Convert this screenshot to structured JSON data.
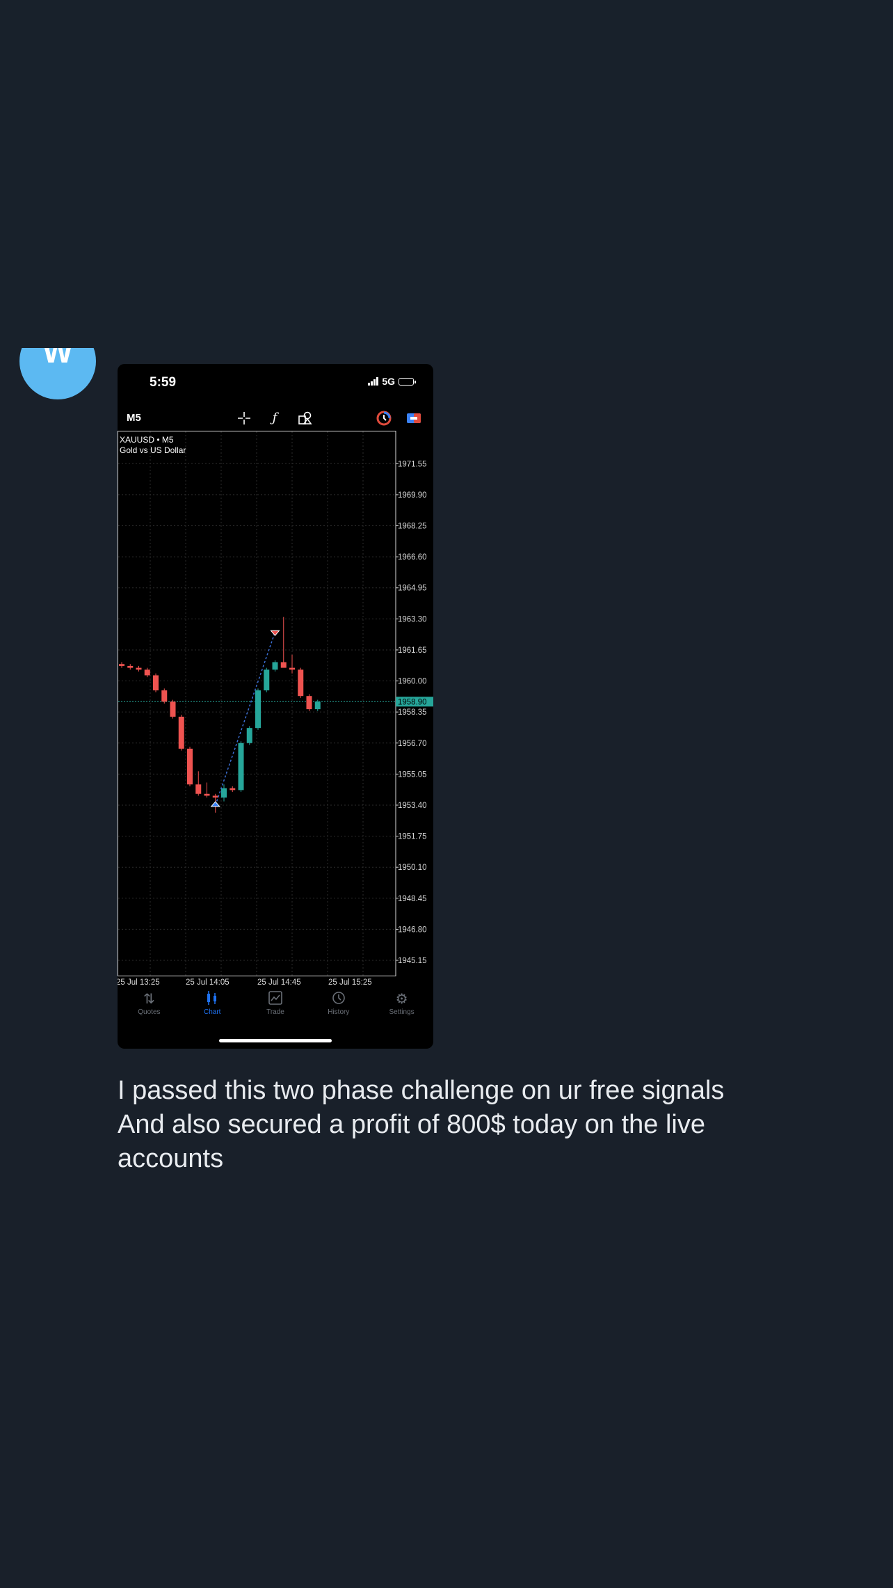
{
  "avatar": {
    "letter": "W",
    "color": "#5cb9f2"
  },
  "status_bar": {
    "time": "5:59",
    "network": "5G"
  },
  "toolbar": {
    "timeframe": "M5",
    "icons": [
      "crosshair-icon",
      "function-icon",
      "objects-icon",
      "signal-icon",
      "exchange-icon"
    ]
  },
  "chart_header": {
    "symbol": "XAUUSD • M5",
    "description": "Gold vs US Dollar"
  },
  "chart_data": {
    "type": "candlestick",
    "symbol": "XAUUSD",
    "timeframe": "M5",
    "y_ticks": [
      "1971.55",
      "1969.90",
      "1968.25",
      "1966.60",
      "1964.95",
      "1963.30",
      "1961.65",
      "1960.00",
      "1958.35",
      "1956.70",
      "1955.05",
      "1953.40",
      "1951.75",
      "1950.10",
      "1948.45",
      "1946.80",
      "1945.15"
    ],
    "ylim": [
      1944.3,
      1973.3
    ],
    "x_ticks": [
      "25 Jul 13:25",
      "25 Jul 14:05",
      "25 Jul 14:45",
      "25 Jul 15:25"
    ],
    "current_price": "1958.90",
    "colors": {
      "bull": "#26a69a",
      "bear": "#ef5350",
      "grid": "#2c2c2c",
      "trendline": "#3b6fd4"
    },
    "candles": [
      {
        "o": 1960.9,
        "h": 1961.0,
        "l": 1960.7,
        "c": 1960.8
      },
      {
        "o": 1960.8,
        "h": 1960.9,
        "l": 1960.6,
        "c": 1960.7
      },
      {
        "o": 1960.7,
        "h": 1960.8,
        "l": 1960.5,
        "c": 1960.6
      },
      {
        "o": 1960.6,
        "h": 1960.7,
        "l": 1960.2,
        "c": 1960.3
      },
      {
        "o": 1960.3,
        "h": 1960.4,
        "l": 1959.4,
        "c": 1959.5
      },
      {
        "o": 1959.5,
        "h": 1959.6,
        "l": 1958.8,
        "c": 1958.9
      },
      {
        "o": 1958.9,
        "h": 1959.0,
        "l": 1958.0,
        "c": 1958.1
      },
      {
        "o": 1958.1,
        "h": 1958.2,
        "l": 1956.3,
        "c": 1956.4
      },
      {
        "o": 1956.4,
        "h": 1956.5,
        "l": 1954.4,
        "c": 1954.5
      },
      {
        "o": 1954.5,
        "h": 1955.2,
        "l": 1953.9,
        "c": 1954.0
      },
      {
        "o": 1954.0,
        "h": 1954.6,
        "l": 1953.8,
        "c": 1953.9
      },
      {
        "o": 1953.9,
        "h": 1954.0,
        "l": 1953.0,
        "c": 1953.8
      },
      {
        "o": 1953.8,
        "h": 1954.5,
        "l": 1953.6,
        "c": 1954.3
      },
      {
        "o": 1954.3,
        "h": 1954.4,
        "l": 1954.1,
        "c": 1954.2
      },
      {
        "o": 1954.2,
        "h": 1956.8,
        "l": 1954.1,
        "c": 1956.7
      },
      {
        "o": 1956.7,
        "h": 1957.6,
        "l": 1956.6,
        "c": 1957.5
      },
      {
        "o": 1957.5,
        "h": 1959.6,
        "l": 1957.4,
        "c": 1959.5
      },
      {
        "o": 1959.5,
        "h": 1960.7,
        "l": 1959.4,
        "c": 1960.6
      },
      {
        "o": 1960.6,
        "h": 1961.1,
        "l": 1960.5,
        "c": 1961.0
      },
      {
        "o": 1961.0,
        "h": 1963.4,
        "l": 1960.8,
        "c": 1960.7
      },
      {
        "o": 1960.7,
        "h": 1961.4,
        "l": 1960.4,
        "c": 1960.6
      },
      {
        "o": 1960.6,
        "h": 1960.7,
        "l": 1959.1,
        "c": 1959.2
      },
      {
        "o": 1959.2,
        "h": 1959.3,
        "l": 1958.4,
        "c": 1958.5
      },
      {
        "o": 1958.5,
        "h": 1959.0,
        "l": 1958.4,
        "c": 1958.9
      }
    ],
    "trades": [
      {
        "type": "buy",
        "candle": 11,
        "price": 1953.4
      },
      {
        "type": "sell",
        "candle": 18,
        "price": 1962.6
      }
    ]
  },
  "tabs": [
    {
      "label": "Quotes",
      "icon": "quotes-icon"
    },
    {
      "label": "Chart",
      "icon": "chart-icon"
    },
    {
      "label": "Trade",
      "icon": "trade-icon"
    },
    {
      "label": "History",
      "icon": "history-icon"
    },
    {
      "label": "Settings",
      "icon": "settings-icon"
    }
  ],
  "active_tab": "Chart",
  "caption": {
    "line1": "I passed this two phase challenge on ur free signals",
    "line2": "And also secured a profit of 800$ today on the live",
    "line3": "accounts"
  }
}
